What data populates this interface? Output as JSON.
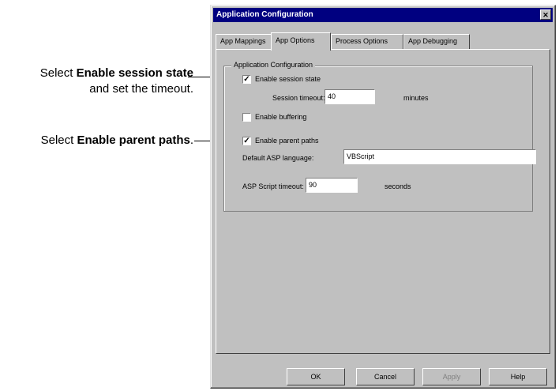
{
  "callouts": [
    {
      "line1_prefix": "Select ",
      "line1_bold": "Enable session state",
      "line2": "and set the timeout."
    },
    {
      "prefix": "Select ",
      "bold": "Enable parent paths",
      "suffix": "."
    }
  ],
  "window": {
    "title": "Application Configuration",
    "close_glyph": "✕"
  },
  "tabs": [
    "App Mappings",
    "App Options",
    "Process Options",
    "App Debugging"
  ],
  "active_tab": "App Options",
  "group_label": "Application Configuration",
  "options": {
    "session_state": {
      "label": "Enable session state",
      "checked": true,
      "mark": "✓"
    },
    "session_timeout": {
      "label": "Session timeout:",
      "value": "40",
      "unit": "minutes"
    },
    "buffering": {
      "label": "Enable buffering",
      "checked": false,
      "mark": ""
    },
    "parent_paths": {
      "label": "Enable parent paths",
      "checked": true,
      "mark": "✓"
    },
    "default_language": {
      "label": "Default ASP language:",
      "value": "VBScript"
    },
    "script_timeout": {
      "label": "ASP Script timeout:",
      "value": "90",
      "unit": "seconds"
    }
  },
  "buttons": {
    "ok": "OK",
    "cancel": "Cancel",
    "apply": "Apply",
    "help": "Help"
  }
}
